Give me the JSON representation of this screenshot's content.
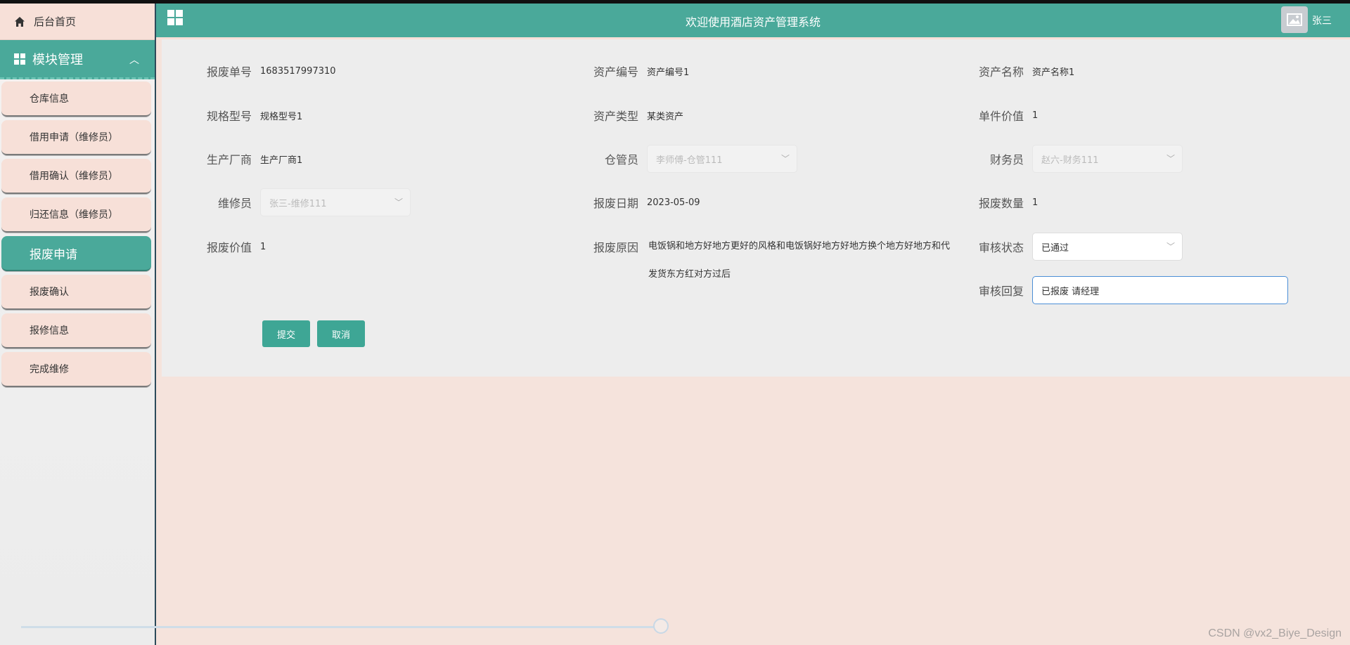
{
  "header": {
    "title": "欢迎使用酒店资产管理系统",
    "username": "张三"
  },
  "sidebar": {
    "home_label": "后台首页",
    "module_label": "模块管理",
    "items": [
      {
        "label": "仓库信息"
      },
      {
        "label": "借用申请（维修员）"
      },
      {
        "label": "借用确认（维修员）"
      },
      {
        "label": "归还信息（维修员）"
      },
      {
        "label": "报废申请",
        "active": true
      },
      {
        "label": "报废确认"
      },
      {
        "label": "报修信息"
      },
      {
        "label": "完成维修"
      }
    ]
  },
  "form": {
    "scrap_no": {
      "label": "报废单号",
      "value": "1683517997310"
    },
    "asset_no": {
      "label": "资产编号",
      "value": "资产编号1"
    },
    "asset_name": {
      "label": "资产名称",
      "value": "资产名称1"
    },
    "spec": {
      "label": "规格型号",
      "value": "规格型号1"
    },
    "asset_type": {
      "label": "资产类型",
      "value": "某类资产"
    },
    "unit_value": {
      "label": "单件价值",
      "value": "1"
    },
    "manufacturer": {
      "label": "生产厂商",
      "value": "生产厂商1"
    },
    "warehouse_keeper": {
      "label": "仓管员",
      "value": "李师傅-仓管111"
    },
    "finance": {
      "label": "财务员",
      "value": "赵六-财务111"
    },
    "repairman": {
      "label": "维修员",
      "value": "张三-维修111"
    },
    "scrap_date": {
      "label": "报废日期",
      "value": "2023-05-09"
    },
    "scrap_qty": {
      "label": "报废数量",
      "value": "1"
    },
    "scrap_value": {
      "label": "报废价值",
      "value": "1"
    },
    "scrap_reason": {
      "label": "报废原因",
      "value": "电饭锅和地方好地方更好的风格和电饭锅好地方好地方换个地方好地方和代发货东方红对方过后"
    },
    "audit_status": {
      "label": "审核状态",
      "value": "已通过"
    },
    "audit_reply": {
      "label": "审核回复",
      "value": "已报废  请经理"
    }
  },
  "buttons": {
    "submit": "提交",
    "cancel": "取消"
  },
  "watermark": "CSDN @vx2_Biye_Design"
}
